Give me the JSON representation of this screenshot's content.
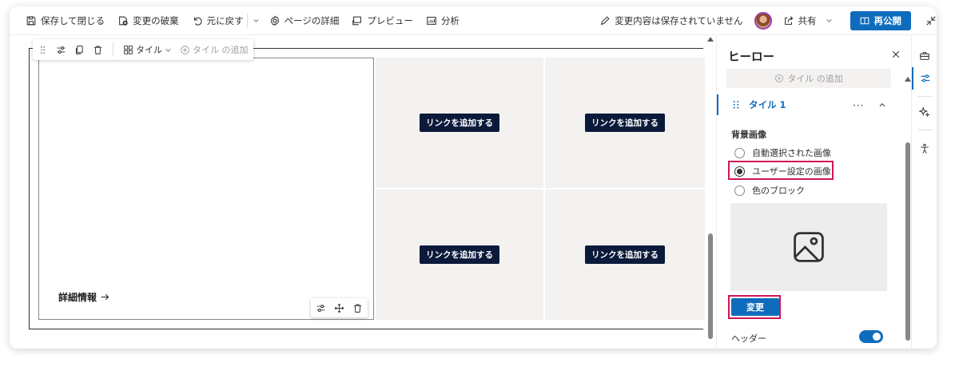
{
  "commandbar": {
    "save_close": "保存して閉じる",
    "discard": "変更の破棄",
    "undo": "元に戻す",
    "page_details": "ページの詳細",
    "preview": "プレビュー",
    "analytics": "分析",
    "unsaved_status": "変更内容は保存されていません",
    "share": "共有",
    "republish": "再公開"
  },
  "section_toolbar": {
    "tile_label": "タイル",
    "add_tile": "タイル の追加"
  },
  "hero": {
    "more_info": "詳細情報",
    "tiles": [
      {
        "link_label": "リンクを追加する"
      },
      {
        "link_label": "リンクを追加する"
      },
      {
        "link_label": "リンクを追加する"
      },
      {
        "link_label": "リンクを追加する"
      }
    ]
  },
  "pane": {
    "title": "ヒーロー",
    "add_tile": "タイル の追加",
    "tile_name": "タイル 1",
    "more": "···",
    "background_label": "背景画像",
    "options": [
      {
        "label": "自動選択された画像",
        "selected": false
      },
      {
        "label": "ユーザー設定の画像",
        "selected": true
      },
      {
        "label": "色のブロック",
        "selected": false
      }
    ],
    "change_button": "変更",
    "header_label": "ヘッダー",
    "header_on": true
  },
  "colors": {
    "accent": "#0f6cbd",
    "highlight": "#d2145a",
    "link_button": "#0b1a3a"
  }
}
